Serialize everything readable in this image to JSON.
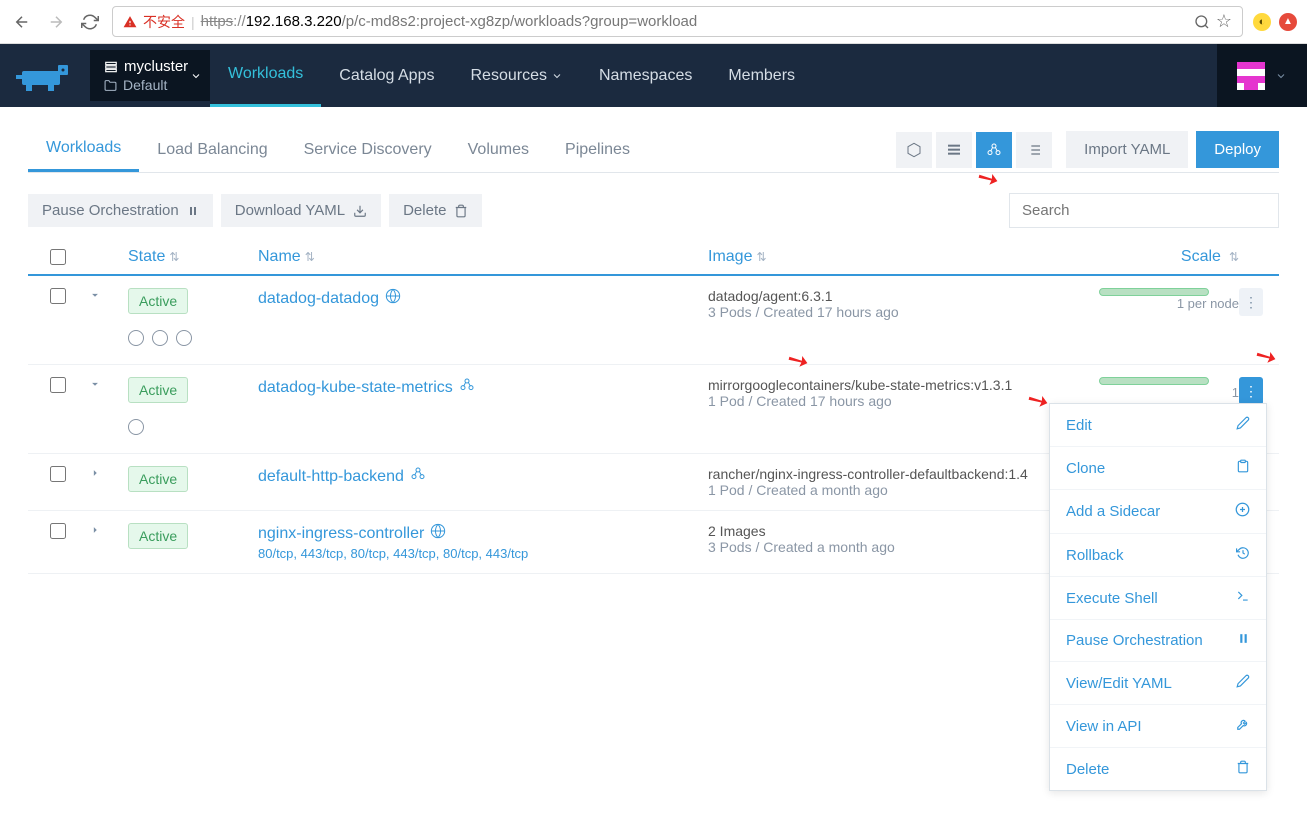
{
  "browser": {
    "insecure_label": "不安全",
    "url_scheme": "https",
    "url_host": "192.168.3.220",
    "url_path": "/p/c-md8s2:project-xg8zp/workloads?group=workload"
  },
  "cluster": {
    "name": "mycluster",
    "project": "Default"
  },
  "topnav": {
    "workloads": "Workloads",
    "catalog": "Catalog Apps",
    "resources": "Resources",
    "namespaces": "Namespaces",
    "members": "Members"
  },
  "subtabs": {
    "workloads": "Workloads",
    "load_balancing": "Load Balancing",
    "service_discovery": "Service Discovery",
    "volumes": "Volumes",
    "pipelines": "Pipelines"
  },
  "buttons": {
    "import_yaml": "Import YAML",
    "deploy": "Deploy",
    "pause": "Pause Orchestration",
    "download_yaml": "Download YAML",
    "delete": "Delete"
  },
  "search_placeholder": "Search",
  "columns": {
    "state": "State",
    "name": "Name",
    "image": "Image",
    "scale": "Scale"
  },
  "state_active": "Active",
  "workloads": [
    {
      "name": "datadog-datadog",
      "icon": "globe",
      "image": "datadog/agent:6.3.1",
      "meta": "3 Pods / Created 17 hours ago",
      "scale": "1 per node",
      "pods": 3,
      "expanded": true,
      "kebab": "muted"
    },
    {
      "name": "datadog-kube-state-metrics",
      "icon": "cube",
      "image": "mirrorgooglecontainers/kube-state-metrics:v1.3.1",
      "meta": "1 Pod / Created 17 hours ago",
      "scale": "1",
      "pods": 1,
      "expanded": true,
      "kebab": "on",
      "menu_open": true
    },
    {
      "name": "default-http-backend",
      "icon": "cube",
      "image": "rancher/nginx-ingress-controller-defaultbackend:1.4",
      "meta": "1 Pod / Created a month ago",
      "expanded": false
    },
    {
      "name": "nginx-ingress-controller",
      "icon": "globe",
      "sub": "80/tcp, 443/tcp, 80/tcp, 443/tcp, 80/tcp, 443/tcp",
      "image": "2 Images",
      "meta": "3 Pods / Created a month ago",
      "expanded": false
    }
  ],
  "context_menu": [
    {
      "label": "Edit",
      "icon": "pencil"
    },
    {
      "label": "Clone",
      "icon": "clipboard"
    },
    {
      "label": "Add a Sidecar",
      "icon": "plus-circle"
    },
    {
      "label": "Rollback",
      "icon": "history"
    },
    {
      "label": "Execute Shell",
      "icon": "terminal"
    },
    {
      "label": "Pause Orchestration",
      "icon": "pause"
    },
    {
      "label": "View/Edit YAML",
      "icon": "pencil"
    },
    {
      "label": "View in API",
      "icon": "tools"
    },
    {
      "label": "Delete",
      "icon": "trash"
    }
  ]
}
